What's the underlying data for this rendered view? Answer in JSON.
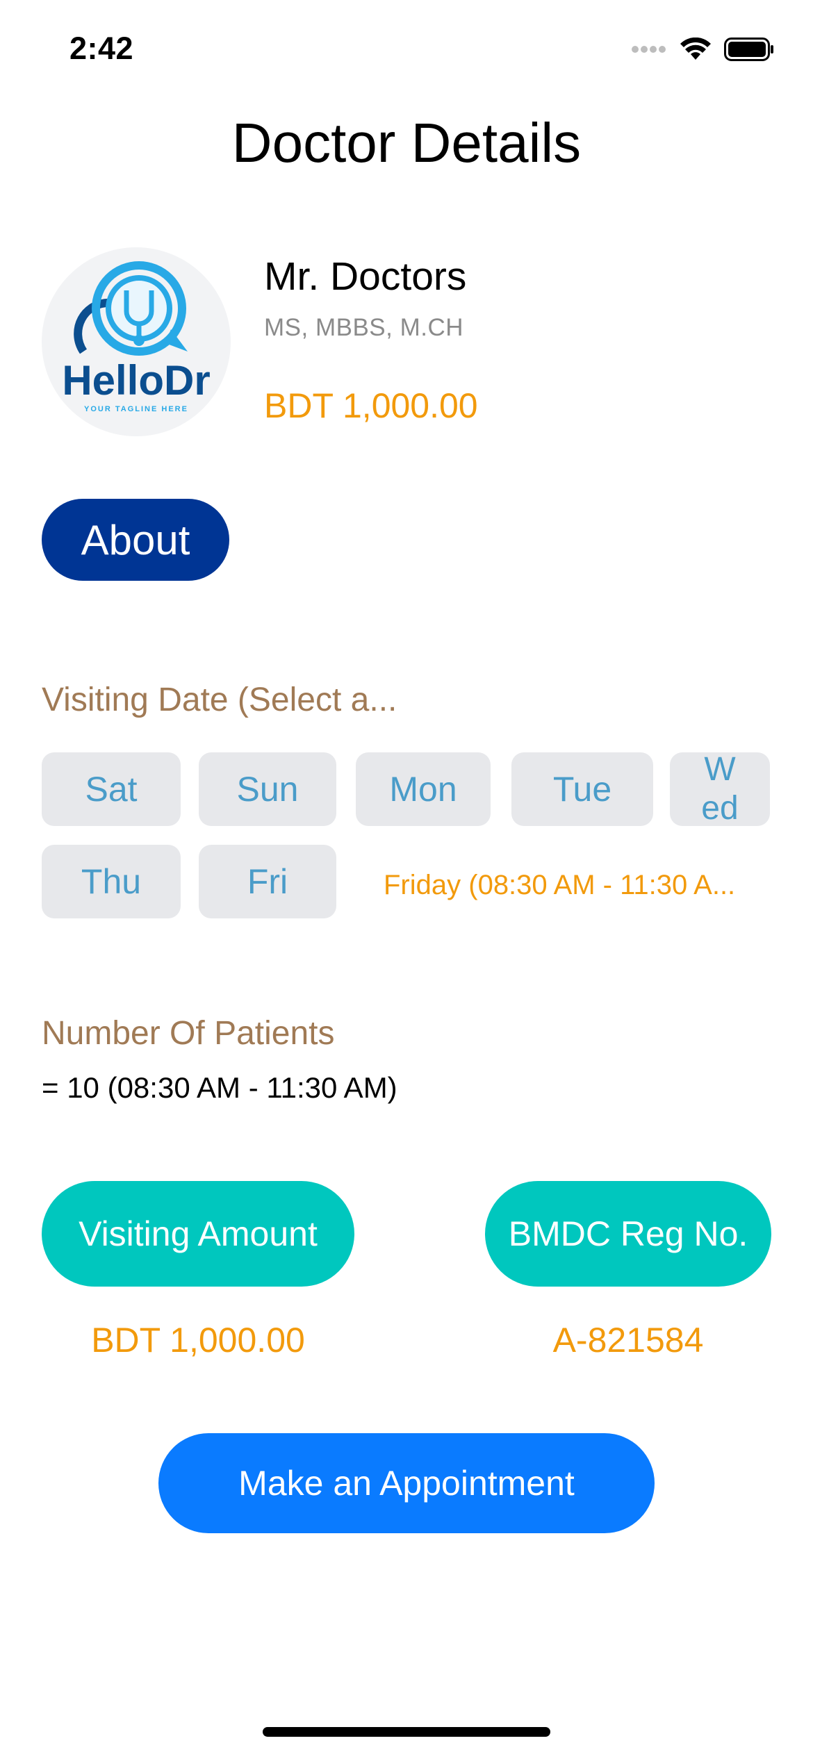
{
  "status_bar": {
    "time": "2:42"
  },
  "header": {
    "title": "Doctor Details"
  },
  "doctor": {
    "logo_text": "HelloDr",
    "logo_tagline": "YOUR TAGLINE HERE",
    "name": "Mr. Doctors",
    "degrees": "MS, MBBS, M.CH",
    "fee": "BDT 1,000.00"
  },
  "about_button": "About",
  "visiting_date": {
    "label": "Visiting Date (Select a...",
    "days": [
      "Sat",
      "Sun",
      "Mon",
      "Tue",
      "W\ned",
      "Thu",
      "Fri"
    ],
    "schedule": "Friday (08:30 AM - 11:30 A..."
  },
  "patients": {
    "label": "Number Of Patients",
    "value": "= 10 (08:30 AM - 11:30 AM)"
  },
  "visiting_amount": {
    "label": "Visiting Amount",
    "value": "BDT 1,000.00"
  },
  "bmdc": {
    "label": "BMDC Reg No.",
    "value": "A-821584"
  },
  "appointment_button": "Make an Appointment",
  "colors": {
    "navy": "#003594",
    "teal": "#00c7be",
    "blue": "#0a7bff",
    "orange": "#f29a0c",
    "label_brown": "#a07a55",
    "day_text": "#4a9cc9"
  }
}
